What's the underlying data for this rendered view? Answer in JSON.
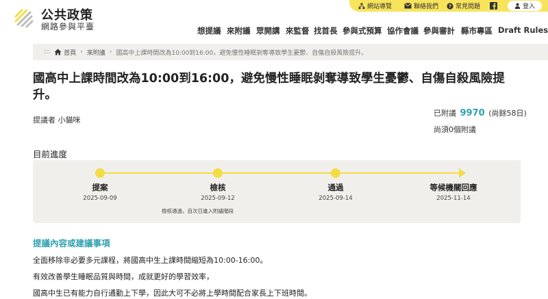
{
  "header": {
    "site_title": "公共政策",
    "site_subtitle": "網路參與平臺",
    "utility": {
      "sitemap": "網站導覽",
      "contact": "聯絡我們",
      "faq": "常見問題",
      "login": "登入"
    },
    "nav": [
      "想提議",
      "來附議",
      "眾開講",
      "來監督",
      "找首長",
      "參與式預算",
      "協作會議",
      "參與審計",
      "縣市專區",
      "Draft Rules"
    ]
  },
  "breadcrumb": {
    "dots": ":::",
    "home": "首頁",
    "section": "來附議",
    "current": "國高中上課時間改為10:00到16:00，避免慢性睡眠剝奪導致學生憂鬱、自傷自殺風險提升。"
  },
  "proposal": {
    "title_line1": "國高中上課時間改為10:00到16:00，避免慢性睡眠剝奪導致學生憂鬱、自傷自殺風險提",
    "title_line2": "升。",
    "proposer": "提議者 小貓咪",
    "signed_prefix": "已附議",
    "signed_count": "9970",
    "signed_suffix": "(尚餘58日)",
    "need_more": "尚須0個附議"
  },
  "progress": {
    "heading": "目前進度",
    "stages": [
      {
        "label": "提案",
        "date": "2025-09-09"
      },
      {
        "label": "檢核",
        "date": "2025-09-12"
      },
      {
        "label": "通過",
        "date": "2025-09-14"
      },
      {
        "label": "等候機關回應",
        "date": "2025-11-14"
      }
    ],
    "note": "檢核通過，自次日進入附議階段"
  },
  "content": {
    "heading": "提議內容或建議事項",
    "lines": [
      "全面移除非必要多元課程，將國高中生上課時間縮短為10:00-16:00。",
      "有效改善學生睡眠品質與時間，成就更好的學習效率，",
      "國高中生已有能力自行通勤上下學，因此大可不必將上學時間配合家長上下班時間。"
    ]
  },
  "colors": {
    "accent_yellow": "#f3dc45",
    "accent_teal": "#2fa0b0",
    "panel_gray": "#f0efeb"
  }
}
